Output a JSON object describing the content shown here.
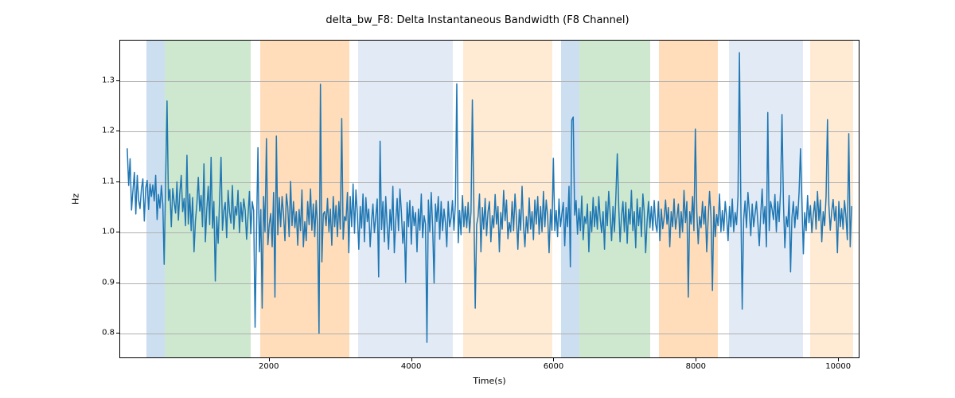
{
  "chart_data": {
    "type": "line",
    "title": "delta_bw_F8: Delta Instantaneous Bandwidth (F8 Channel)",
    "xlabel": "Time(s)",
    "ylabel": "Hz",
    "xlim": [
      -100,
      10300
    ],
    "ylim": [
      0.75,
      1.38
    ],
    "xticks": [
      2000,
      4000,
      6000,
      8000,
      10000
    ],
    "yticks": [
      0.8,
      0.9,
      1.0,
      1.1,
      1.2,
      1.3
    ],
    "bands": [
      {
        "x0": 270,
        "x1": 530,
        "color": "#c6dcef",
        "alpha": 0.9
      },
      {
        "x0": 530,
        "x1": 1730,
        "color": "#c8e6c9",
        "alpha": 0.9
      },
      {
        "x0": 1870,
        "x1": 3120,
        "color": "#ffd9b3",
        "alpha": 0.9
      },
      {
        "x0": 3240,
        "x1": 4570,
        "color": "#dde8f3",
        "alpha": 0.85
      },
      {
        "x0": 4720,
        "x1": 5970,
        "color": "#ffe7cc",
        "alpha": 0.85
      },
      {
        "x0": 6100,
        "x1": 6350,
        "color": "#c6dcef",
        "alpha": 0.9
      },
      {
        "x0": 6350,
        "x1": 7350,
        "color": "#c8e6c9",
        "alpha": 0.9
      },
      {
        "x0": 7470,
        "x1": 8300,
        "color": "#ffd9b3",
        "alpha": 0.9
      },
      {
        "x0": 8450,
        "x1": 9500,
        "color": "#dde8f3",
        "alpha": 0.85
      },
      {
        "x0": 9600,
        "x1": 10200,
        "color": "#ffe7cc",
        "alpha": 0.85
      }
    ],
    "series": [
      {
        "name": "delta_bw_F8",
        "color": "#1f77b4",
        "x_start": 0,
        "x_step": 20,
        "y": [
          1.165,
          1.092,
          1.145,
          1.043,
          1.082,
          1.118,
          1.035,
          1.112,
          1.062,
          1.046,
          1.086,
          1.105,
          1.021,
          1.087,
          1.102,
          1.044,
          1.095,
          1.07,
          1.093,
          1.061,
          1.112,
          1.024,
          1.074,
          1.047,
          1.092,
          1.054,
          0.935,
          1.095,
          1.26,
          1.062,
          1.084,
          1.01,
          1.086,
          1.059,
          1.037,
          1.099,
          1.023,
          1.077,
          1.112,
          1.04,
          1.066,
          1.012,
          1.152,
          1.015,
          1.075,
          1.002,
          1.068,
          0.96,
          1.022,
          1.055,
          1.108,
          1.041,
          1.072,
          1.01,
          1.135,
          0.98,
          1.045,
          1.09,
          1.014,
          1.148,
          1.007,
          1.06,
          0.902,
          1.03,
          0.977,
          1.064,
          1.148,
          1.003,
          1.042,
          1.058,
          0.988,
          1.082,
          1.04,
          1.017,
          1.092,
          1.005,
          1.05,
          1.033,
          1.082,
          0.998,
          1.058,
          1.02,
          1.065,
          1.043,
          0.985,
          1.032,
          1.08,
          0.996,
          1.06,
          1.042,
          0.81,
          1.0,
          1.167,
          0.96,
          1.044,
          0.848,
          1.07,
          1.0,
          1.185,
          0.974,
          1.015,
          1.036,
          0.97,
          1.078,
          0.87,
          1.19,
          0.994,
          1.068,
          1.01,
          1.07,
          1.035,
          0.982,
          1.075,
          1.05,
          0.99,
          1.1,
          1.012,
          1.06,
          1.008,
          1.04,
          0.973,
          1.044,
          1.002,
          1.083,
          0.97,
          1.02,
          0.982,
          1.06,
          1.014,
          1.085,
          1.003,
          1.055,
          0.99,
          1.062,
          1.01,
          0.798,
          1.293,
          0.94,
          1.035,
          1.04,
          1.012,
          1.066,
          1.0,
          1.045,
          0.973,
          1.07,
          1.01,
          1.052,
          0.99,
          1.06,
          1.005,
          1.225,
          0.985,
          1.03,
          1.022,
          1.078,
          0.958,
          1.07,
          1.01,
          1.095,
          0.997,
          1.083,
          1.036,
          0.965,
          1.05,
          1.007,
          1.075,
          0.98,
          1.068,
          1.02,
          1.045,
          0.97,
          1.022,
          1.055,
          0.998,
          1.03,
          1.065,
          0.91,
          1.18,
          1.004,
          1.06,
          0.98,
          1.07,
          1.012,
          0.965,
          1.044,
          1.003,
          1.09,
          0.958,
          1.02,
          1.066,
          1.002,
          1.085,
          1.04,
          0.977,
          1.02,
          0.899,
          1.058,
          1.01,
          1.062,
          0.975,
          1.05,
          1.012,
          1.038,
          0.96,
          1.045,
          1.003,
          1.075,
          0.988,
          1.032,
          1.015,
          0.78,
          1.063,
          1.0,
          1.078,
          1.008,
          0.898,
          1.055,
          1.02,
          1.07,
          0.985,
          1.06,
          1.002,
          1.045,
          1.018,
          0.97,
          1.06,
          1.01,
          1.028,
          1.062,
          1.003,
          1.055,
          1.294,
          0.978,
          1.042,
          0.994,
          1.072,
          1.01,
          1.05,
          1.008,
          1.058,
          0.998,
          1.04,
          1.262,
          1.062,
          0.848,
          1.014,
          1.03,
          1.075,
          0.96,
          1.048,
          1.005,
          1.066,
          0.992,
          1.04,
          1.06,
          0.98,
          1.032,
          1.008,
          1.074,
          1.015,
          1.05,
          0.96,
          1.038,
          1.005,
          1.082,
          1.022,
          1.063,
          0.986,
          1.018,
          1.0,
          1.06,
          1.002,
          1.075,
          1.028,
          0.965,
          1.044,
          1.003,
          1.09,
          1.012,
          0.97,
          1.03,
          0.997,
          1.067,
          1.005,
          1.04,
          0.984,
          1.063,
          1.015,
          1.07,
          0.995,
          1.05,
          1.0,
          1.08,
          1.01,
          1.063,
          1.032,
          0.958,
          1.044,
          1.003,
          1.146,
          1.002,
          1.042,
          0.99,
          1.065,
          1.01,
          1.035,
          1.058,
          0.972,
          1.048,
          1.01,
          1.09,
          0.93,
          1.222,
          1.228,
          1.033,
          1.062,
          0.995,
          1.046,
          1.002,
          1.071,
          0.984,
          1.03,
          1.016,
          1.055,
          0.96,
          1.04,
          1.0,
          1.068,
          1.01,
          1.05,
          1.005,
          1.07,
          1.025,
          0.998,
          1.04,
          0.965,
          1.06,
          1.012,
          1.08,
          1.035,
          0.982,
          1.05,
          1.0,
          1.07,
          1.155,
          1.05,
          0.98,
          1.03,
          1.06,
          1.0,
          1.058,
          0.977,
          1.045,
          1.015,
          1.082,
          1.002,
          1.04,
          0.968,
          1.065,
          1.012,
          1.048,
          0.99,
          1.075,
          1.04,
          0.958,
          1.02,
          1.06,
          1.008,
          1.05,
          1.003,
          1.062,
          1.015,
          1.0,
          1.06,
          0.982,
          1.045,
          1.006,
          1.028,
          1.063,
          1.015,
          1.048,
          0.97,
          1.04,
          1.01,
          1.065,
          1.005,
          1.028,
          1.055,
          0.988,
          1.04,
          1.0,
          1.082,
          1.018,
          1.06,
          0.87,
          1.04,
          1.015,
          1.07,
          1.002,
          1.204,
          1.04,
          0.976,
          1.03,
          1.008,
          1.06,
          1.015,
          1.05,
          0.96,
          1.025,
          1.08,
          1.03,
          0.883,
          1.05,
          0.99,
          1.034,
          1.012,
          1.075,
          1.0,
          1.042,
          1.002,
          1.06,
          1.03,
          0.982,
          1.05,
          1.01,
          1.065,
          1.0,
          1.038,
          1.014,
          1.07,
          1.356,
          1.052,
          0.846,
          1.024,
          1.061,
          1.008,
          1.078,
          1.04,
          0.992,
          1.055,
          1.01,
          1.034,
          1.06,
          1.018,
          0.972,
          1.033,
          1.085,
          1.016,
          1.05,
          0.97,
          1.237,
          1.002,
          1.06,
          1.045,
          1.024,
          1.074,
          1.0,
          1.06,
          1.02,
          1.082,
          1.233,
          1.058,
          0.968,
          1.03,
          1.01,
          1.072,
          0.92,
          1.028,
          1.06,
          1.008,
          1.05,
          1.025,
          1.078,
          1.165,
          1.06,
          0.956,
          1.038,
          1.002,
          1.072,
          1.018,
          1.052,
          0.998,
          1.034,
          1.06,
          1.005,
          1.08,
          1.022,
          1.063,
          0.98,
          1.04,
          1.012,
          1.07,
          1.223,
          1.054,
          1.003,
          1.04,
          1.064,
          1.022,
          1.05,
          0.958,
          1.06,
          1.01,
          1.046,
          1.005,
          1.062,
          1.03,
          0.984,
          1.195,
          0.97,
          1.05
        ]
      }
    ]
  }
}
